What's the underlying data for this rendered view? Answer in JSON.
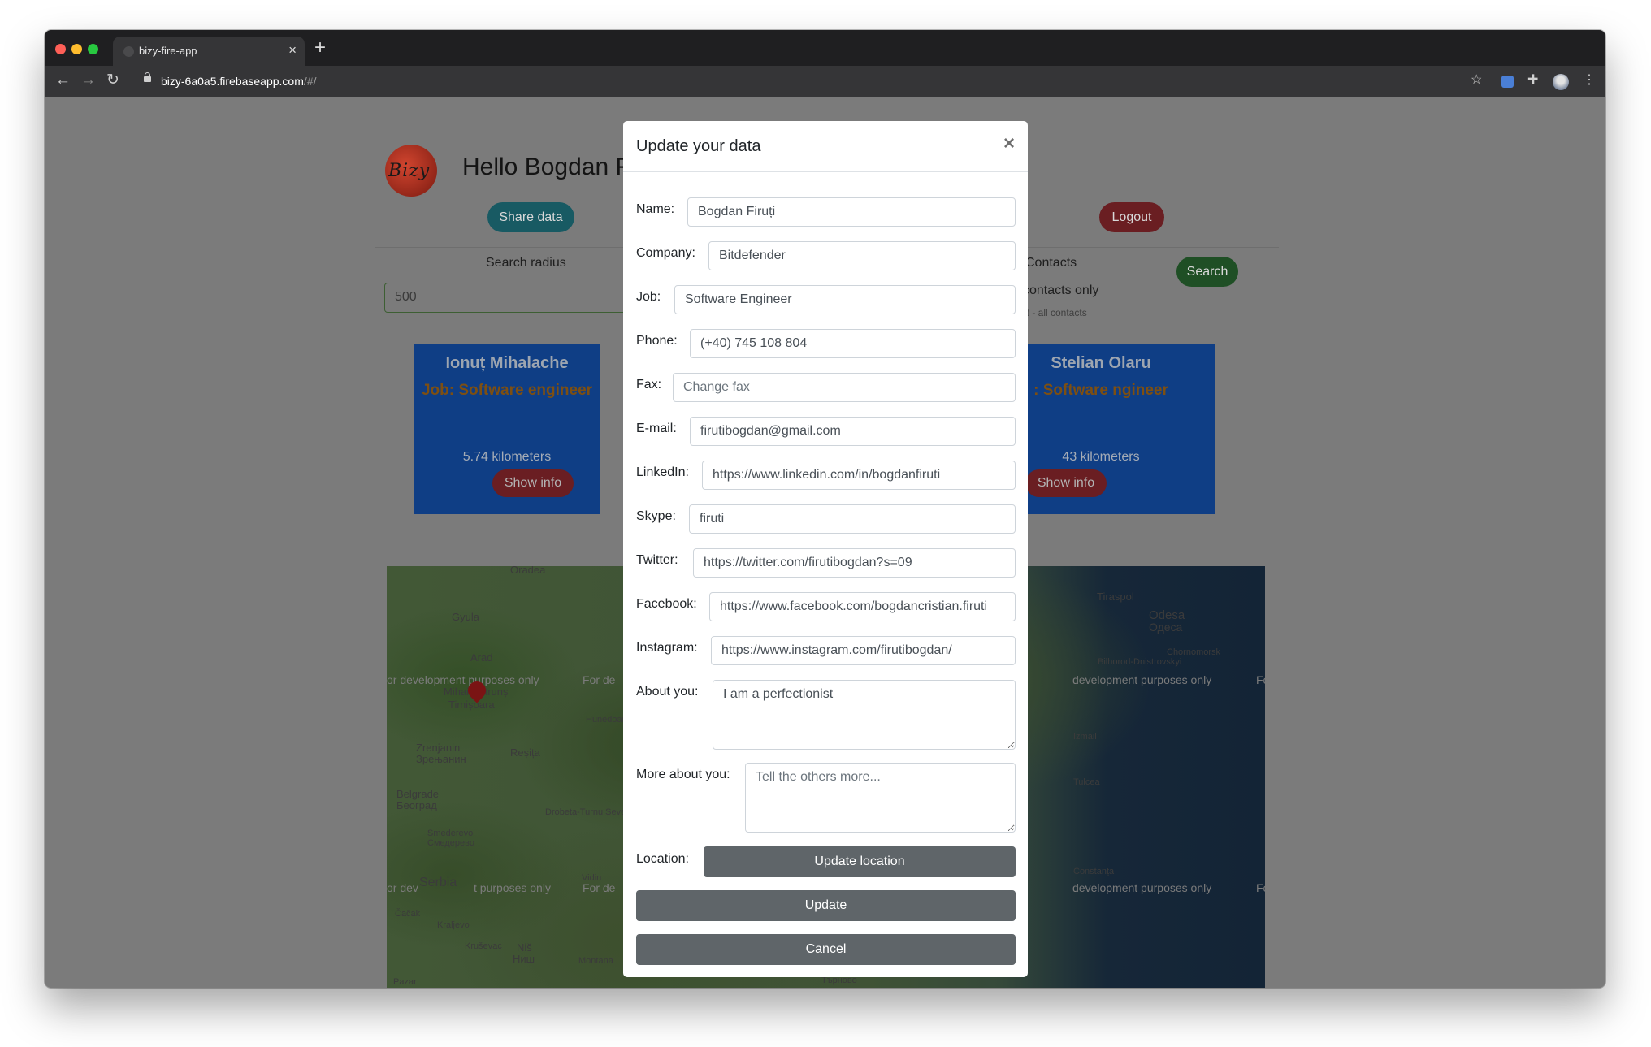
{
  "browser": {
    "tab_title": "bizy-fire-app",
    "url_host": "bizy-6a0a5.firebaseapp.com",
    "url_path": "/#/"
  },
  "app": {
    "logo_text": "Bizy",
    "greeting": "Hello Bogdan F",
    "share_button": "Share data",
    "logout_button": "Logout",
    "search_radius_label": "Search radius",
    "search_radius_value": "500",
    "contacts_label": "Contacts",
    "contacts_option": "contacts only",
    "contacts_hint": "lt - all contacts",
    "search_button": "Search",
    "cards": [
      {
        "name": "Ionuț Mihalache",
        "job": "Job: Software engineer",
        "distance": "5.74 kilometers",
        "button": "Show info"
      },
      {
        "name": "Stelian Olaru",
        "job": ": Software ngineer",
        "distance": "43 kilometers",
        "button": "Show info"
      }
    ]
  },
  "map": {
    "places": [
      "Oradea",
      "Gyula",
      "Arad",
      "Mihai Pătrunș",
      "Timișoara",
      "Hunedoara",
      "Zrenjanin",
      "Зрењанин",
      "Reșița",
      "Belgrade",
      "Београд",
      "Smederevo",
      "Смедерево",
      "Drobeta-Turnu Severin",
      "Serbia",
      "Čačak",
      "Kraljevo",
      "Kruševac",
      "Niš",
      "Ниш",
      "Vidin",
      "Montana",
      "Tiraspol",
      "Odesa",
      "Одеса",
      "Chornomorsk",
      "Bilhorod-Dnistrovskyi",
      "Izmail",
      "Tulcea",
      "Constanța",
      "Търново",
      "Pazar"
    ],
    "dev_watermark": "For development purposes only",
    "dev_watermark_fragments": [
      "or development purposes only",
      "For de",
      "development purposes only",
      "For devel",
      "or dev",
      "t purposes only"
    ]
  },
  "modal": {
    "title": "Update your data",
    "close_symbol": "×",
    "fields": {
      "name": {
        "label": "Name:",
        "value": "Bogdan Firuți"
      },
      "company": {
        "label": "Company:",
        "value": "Bitdefender"
      },
      "job": {
        "label": "Job:",
        "value": "Software Engineer"
      },
      "phone": {
        "label": "Phone:",
        "value": "(+40) 745 108 804"
      },
      "fax": {
        "label": "Fax:",
        "placeholder": "Change fax"
      },
      "email": {
        "label": "E-mail:",
        "value": "firutibogdan@gmail.com"
      },
      "linkedin": {
        "label": "LinkedIn:",
        "value": "https://www.linkedin.com/in/bogdanfiruti"
      },
      "skype": {
        "label": "Skype:",
        "value": "firuti"
      },
      "twitter": {
        "label": "Twitter:",
        "value": "https://twitter.com/firutibogdan?s=09"
      },
      "facebook": {
        "label": "Facebook:",
        "value": "https://www.facebook.com/bogdancristian.firuti"
      },
      "instagram": {
        "label": "Instagram:",
        "value": "https://www.instagram.com/firutibogdan/"
      },
      "about": {
        "label": "About you:",
        "value": "I am a perfectionist"
      },
      "more_about": {
        "label": "More about you:",
        "placeholder": "Tell the others more..."
      },
      "location": {
        "label": "Location:",
        "button": "Update location"
      }
    },
    "update_button": "Update",
    "cancel_button": "Cancel"
  },
  "colors": {
    "overlay": "#7b7b7b",
    "secondary_button": "#5f6569",
    "card_blue": "#0f3e85",
    "modal_bg": "#ffffff"
  }
}
